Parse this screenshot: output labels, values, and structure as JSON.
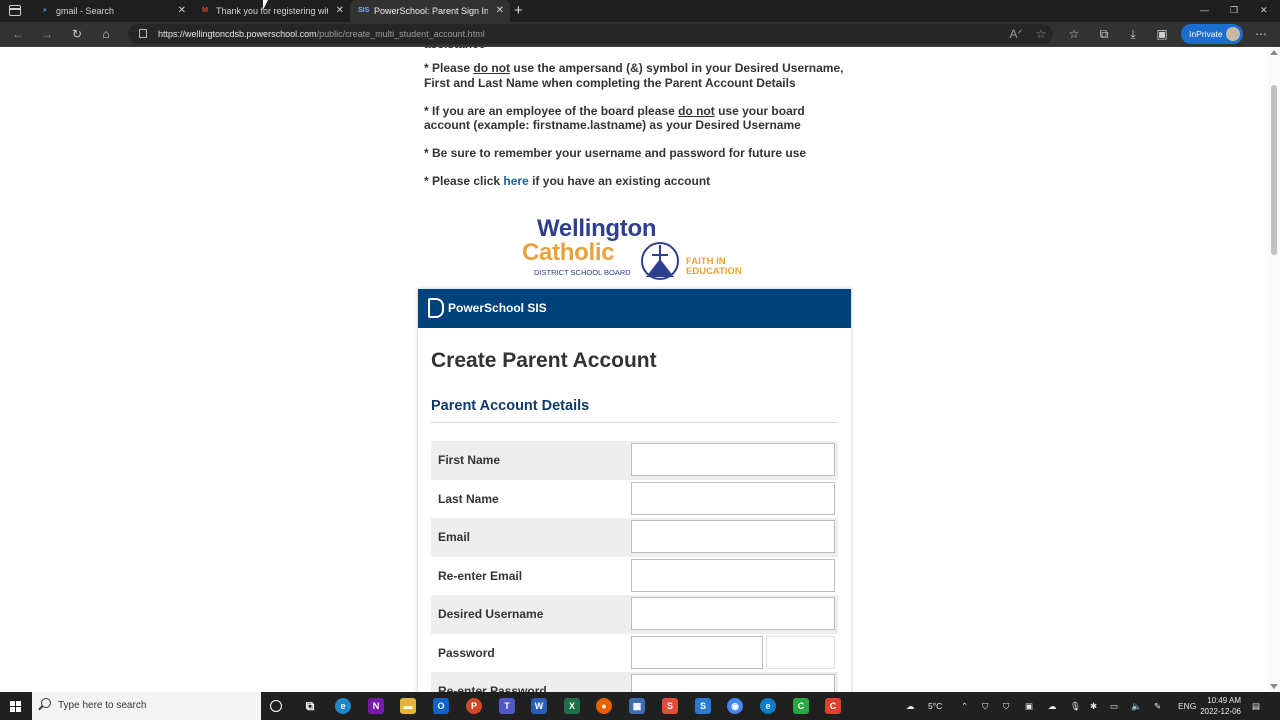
{
  "browser": {
    "tabs": [
      {
        "favicon": "search-icon",
        "title": "gmail - Search"
      },
      {
        "favicon": "gmail-icon",
        "title": "Thank you for registering with t"
      },
      {
        "favicon": "sis-icon",
        "title": "PowerSchool: Parent Sign In"
      }
    ],
    "url_host": "https://wellingtoncdsb.powerschool.com",
    "url_path": "/public/create_multi_student_account.html",
    "inprivate_label": "InPrivate"
  },
  "page": {
    "cut_line": "assistance",
    "note1_pre": "* Please ",
    "note1_em": "do not",
    "note1_post": " use the ampersand (&) symbol in your Desired Username, First and Last Name when completing the Parent Account Details",
    "note2_pre": "* If you are an employee of the board please ",
    "note2_em": "do not",
    "note2_post": " use your board account (example: firstname.lastname) as your Desired Username",
    "note3": "* Be sure to remember your username and password for future use",
    "note4_pre": "* Please click ",
    "note4_link": "here",
    "note4_post": " if you have an existing account",
    "logo": {
      "line1": "Wellington",
      "line2": "Catholic",
      "line3": "DISTRICT SCHOOL BOARD",
      "tag1": "FAITH IN",
      "tag2": "EDUCATION"
    },
    "card_brand": "PowerSchool SIS",
    "title": "Create Parent Account",
    "section": "Parent Account Details",
    "fields": [
      {
        "label": "First Name"
      },
      {
        "label": "Last Name"
      },
      {
        "label": "Email"
      },
      {
        "label": "Re-enter Email"
      },
      {
        "label": "Desired Username"
      },
      {
        "label": "Password"
      },
      {
        "label": "Re-enter Password"
      }
    ]
  },
  "taskbar": {
    "search_placeholder": "Type here to search",
    "weather": "5°C",
    "language": "ENG",
    "time": "10:49 AM",
    "date": "2022-12-06"
  },
  "colors": {
    "header_blue": "#00427c",
    "link_blue": "#1a63a6",
    "logo_navy": "#2e3f8f",
    "logo_gold": "#e8a23a"
  }
}
